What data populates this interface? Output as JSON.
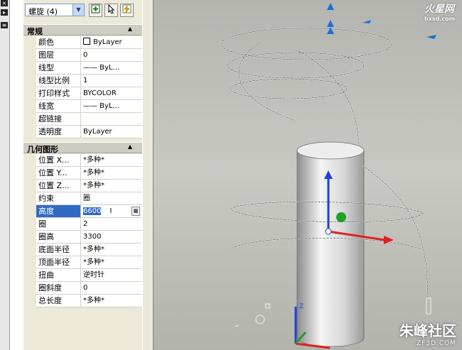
{
  "toolbar": {
    "object_select_value": "螺旋 (4)",
    "buttons": [
      "toggle-pickadd-icon",
      "select-objects-icon",
      "quick-select-icon"
    ]
  },
  "sections": {
    "general": {
      "title": "常规",
      "rows": [
        {
          "name": "颜色",
          "value": "ByLayer"
        },
        {
          "name": "图层",
          "value": "0"
        },
        {
          "name": "线型",
          "value": "—— ByL..."
        },
        {
          "name": "线型比例",
          "value": "1"
        },
        {
          "name": "打印样式",
          "value": "BYCOLOR"
        },
        {
          "name": "线宽",
          "value": "—— ByL..."
        },
        {
          "name": "超链接",
          "value": ""
        },
        {
          "name": "透明度",
          "value": "ByLayer"
        }
      ]
    },
    "geometry": {
      "title": "几何图形",
      "rows": [
        {
          "name": "位置 X...",
          "value": "*多种*"
        },
        {
          "name": "位置 Y...",
          "value": "*多种*"
        },
        {
          "name": "位置 Z...",
          "value": "*多种*"
        },
        {
          "name": "约束",
          "value": "圈"
        },
        {
          "name": "高度",
          "value": "6600"
        },
        {
          "name": "圈",
          "value": "2"
        },
        {
          "name": "圈高",
          "value": "3300"
        },
        {
          "name": "底面半径",
          "value": "*多种*"
        },
        {
          "name": "顶面半径",
          "value": "*多种*"
        },
        {
          "name": "扭曲",
          "value": "逆时针"
        },
        {
          "name": "圈斜度",
          "value": "0"
        },
        {
          "name": "总长度",
          "value": "*多种*"
        }
      ]
    }
  },
  "watermarks": {
    "top": "火星网",
    "top_url": "hxsd.com",
    "bottom": "朱峰社区",
    "bottom_url": "ZF3D.COM"
  },
  "colors": {
    "palette_bg": "#ece9d8",
    "selection": "#316ac5",
    "viewport_bg": "#c0c0bb",
    "axis_x": "#e02020",
    "axis_y": "#20a020",
    "axis_z": "#2040e0"
  }
}
